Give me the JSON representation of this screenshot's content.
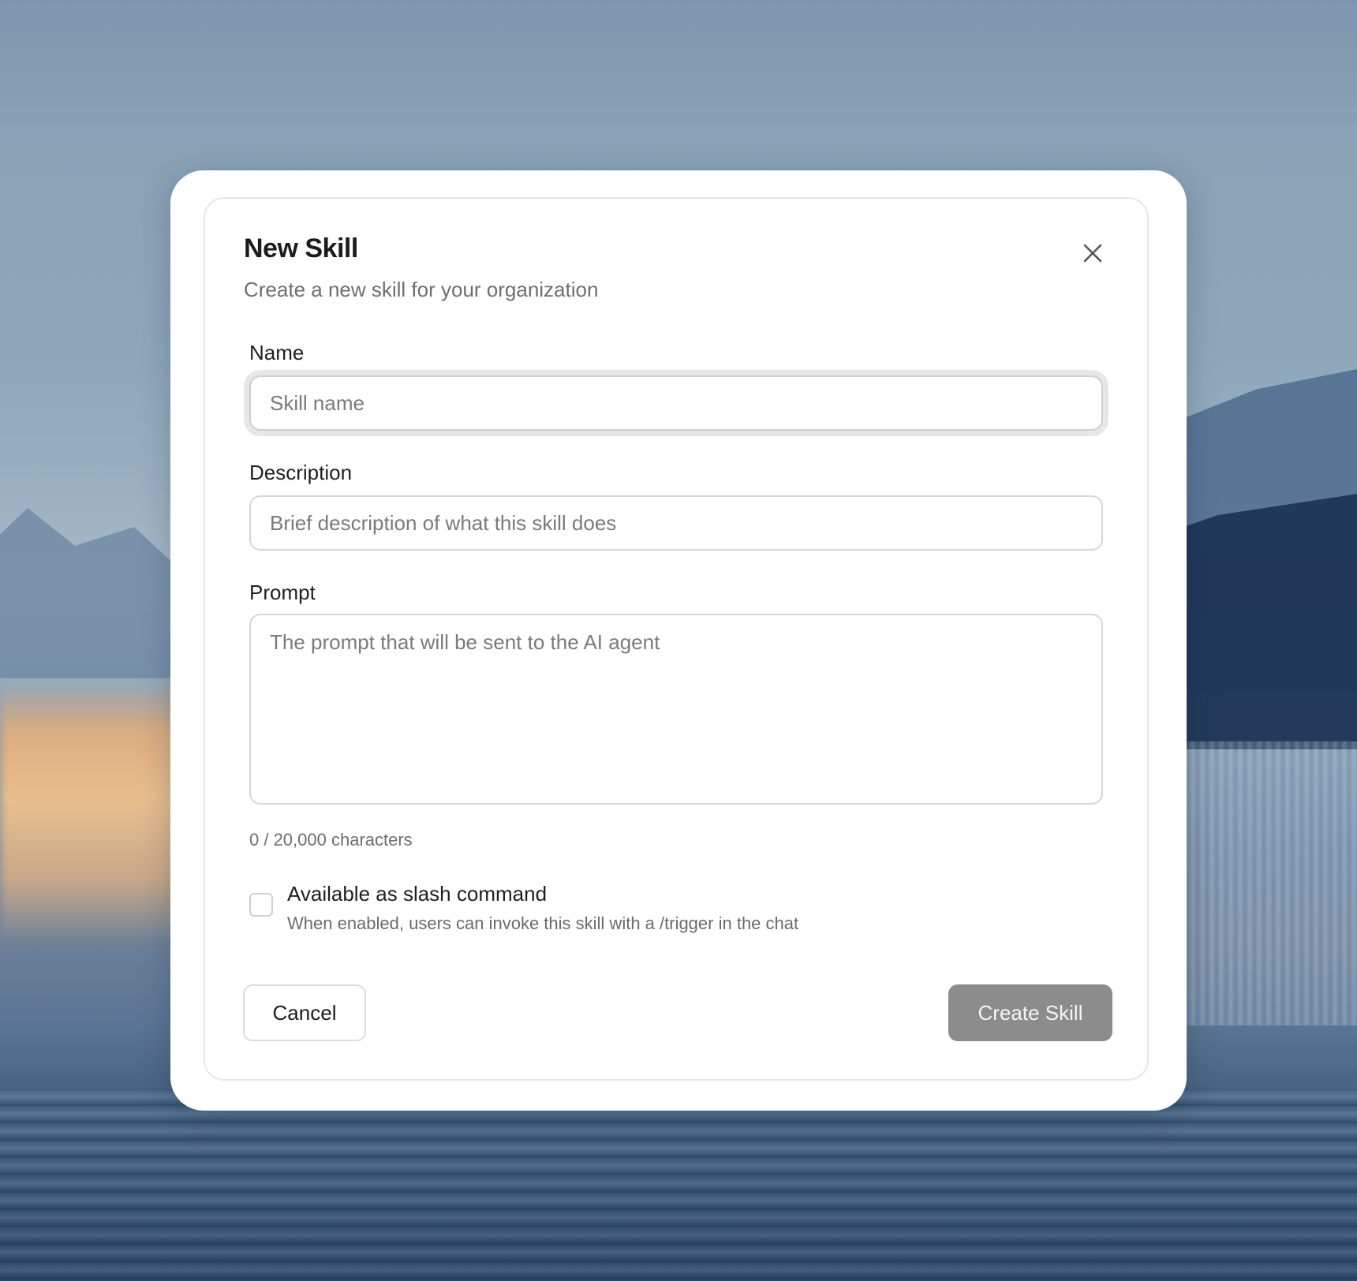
{
  "dialog": {
    "title": "New Skill",
    "subtitle": "Create a new skill for your organization"
  },
  "fields": {
    "name": {
      "label": "Name",
      "placeholder": "Skill name",
      "value": ""
    },
    "description": {
      "label": "Description",
      "placeholder": "Brief description of what this skill does",
      "value": ""
    },
    "prompt": {
      "label": "Prompt",
      "placeholder": "The prompt that will be sent to the AI agent",
      "value": "",
      "counter": "0 / 20,000 characters"
    }
  },
  "slash_command": {
    "label": "Available as slash command",
    "hint": "When enabled, users can invoke this skill with a /trigger in the chat",
    "checked": false
  },
  "actions": {
    "cancel_label": "Cancel",
    "create_label": "Create Skill"
  },
  "icons": {
    "close": "close-icon"
  },
  "colors": {
    "primary_disabled": "#8c8c8c",
    "focus_ring": "#e7e7e7"
  }
}
